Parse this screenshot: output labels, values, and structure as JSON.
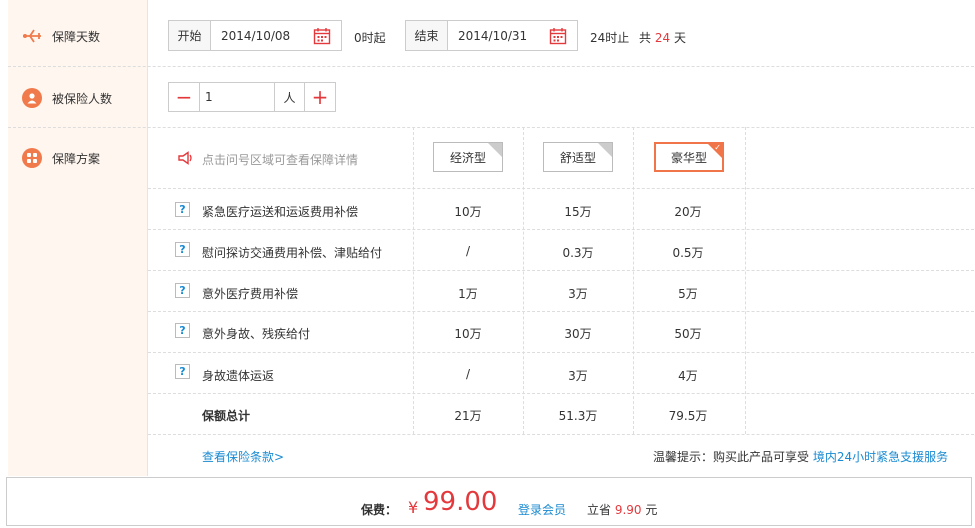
{
  "labels": {
    "days": "保障天数",
    "insured": "被保险人数",
    "plan": "保障方案"
  },
  "dates": {
    "start_label": "开始",
    "start_value": "2014/10/08",
    "start_suffix": "0时起",
    "end_label": "结束",
    "end_value": "2014/10/31",
    "end_suffix": "24时止",
    "total_prefix": "共",
    "total_days": "24",
    "total_unit": "天"
  },
  "insured": {
    "count": "1",
    "unit": "人",
    "minus": "−",
    "plus": "+"
  },
  "plan": {
    "hint": "点击问号区域可查看保障详情",
    "options": [
      "经济型",
      "舒适型",
      "豪华型"
    ],
    "selected_index": 2,
    "help_mark": "?",
    "rows": [
      {
        "name": "紧急医疗运送和运返费用补偿",
        "values": [
          "10万",
          "15万",
          "20万"
        ]
      },
      {
        "name": "慰问探访交通费用补偿、津贴给付",
        "values": [
          "/",
          "0.3万",
          "0.5万"
        ]
      },
      {
        "name": "意外医疗费用补偿",
        "values": [
          "1万",
          "3万",
          "5万"
        ]
      },
      {
        "name": "意外身故、残疾给付",
        "values": [
          "10万",
          "30万",
          "50万"
        ]
      },
      {
        "name": "身故遗体运返",
        "values": [
          "/",
          "3万",
          "4万"
        ]
      }
    ],
    "total": {
      "name": "保额总计",
      "values": [
        "21万",
        "51.3万",
        "79.5万"
      ]
    }
  },
  "footer": {
    "terms_link": "查看保险条款>",
    "tip_prefix": "温馨提示：购买此产品可享受",
    "tip_link": "境内24小时紧急支援服务"
  },
  "price": {
    "label": "保费：",
    "currency": "¥",
    "amount": "99.00",
    "login_link": "登录会员",
    "save_prefix": "立省",
    "save_amount": "9.90",
    "save_unit": "元"
  },
  "colors": {
    "accent": "#f0764a",
    "price_red": "#e4393c",
    "link_blue": "#1a8bd2",
    "left_bg": "#fff6ef"
  }
}
